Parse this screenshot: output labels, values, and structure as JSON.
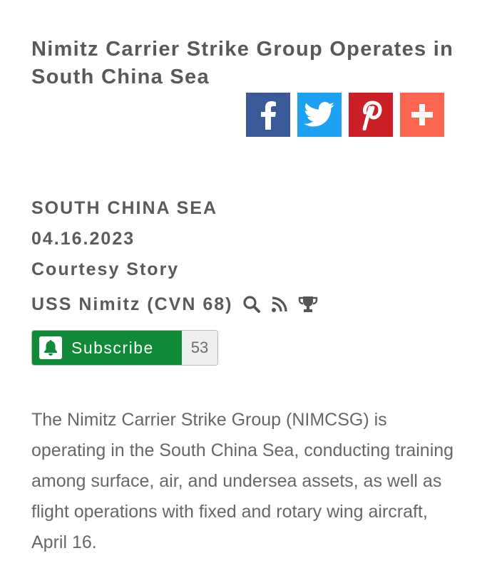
{
  "article": {
    "title": "Nimitz Carrier Strike Group Operates in South China Sea",
    "location": "SOUTH CHINA SEA",
    "date": "04.16.2023",
    "story_type": "Courtesy Story",
    "unit": "USS Nimitz (CVN 68)",
    "body": "The Nimitz Carrier Strike Group (NIMCSG) is operating in the South China Sea, conducting training among surface, air, and undersea assets, as well as flight operations with fixed and rotary wing aircraft, April 16."
  },
  "share": {
    "buttons": [
      {
        "name": "facebook",
        "icon": "facebook-icon",
        "color": "#3b5998"
      },
      {
        "name": "twitter",
        "icon": "twitter-icon",
        "color": "#1da1f2"
      },
      {
        "name": "pinterest",
        "icon": "pinterest-icon",
        "color": "#cb2027"
      },
      {
        "name": "more",
        "icon": "plus-icon",
        "color": "#fa6650"
      }
    ]
  },
  "unit_icons": [
    "search-icon",
    "rss-icon",
    "trophy-icon"
  ],
  "subscribe": {
    "label": "Subscribe",
    "count": "53",
    "color": "#0f8a36"
  }
}
